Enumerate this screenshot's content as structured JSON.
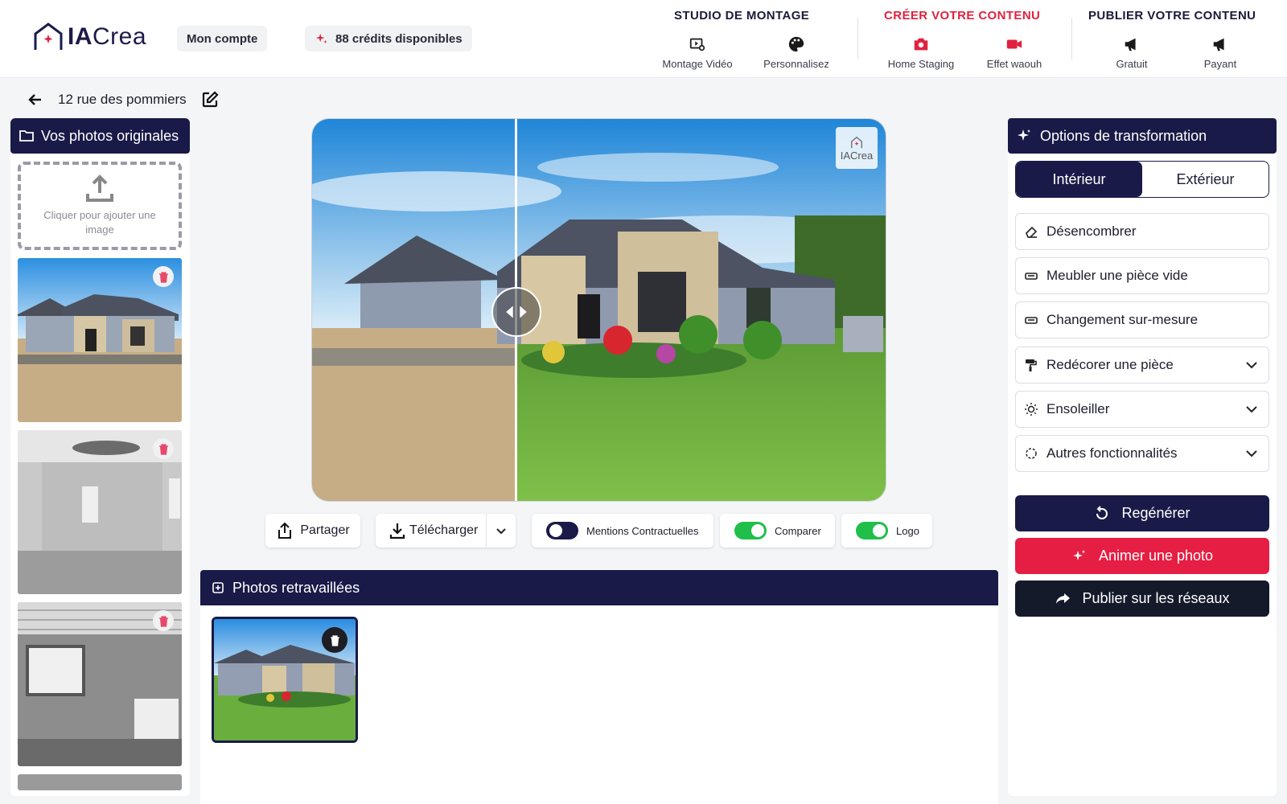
{
  "header": {
    "brand": "IACrea",
    "account_label": "Mon compte",
    "credits_label": "88 crédits disponibles",
    "groups": [
      {
        "title": "STUDIO DE MONTAGE",
        "color": "#1b1b3a",
        "items": [
          {
            "label": "Montage Vidéo",
            "icon": "video-edit-icon"
          },
          {
            "label": "Personnalisez",
            "icon": "palette-icon"
          }
        ]
      },
      {
        "title": "CRÉER VOTRE CONTENU",
        "color": "#e0223f",
        "items": [
          {
            "label": "Home Staging",
            "icon": "camera-icon"
          },
          {
            "label": "Effet waouh",
            "icon": "video-camera-icon"
          }
        ]
      },
      {
        "title": "PUBLIER VOTRE CONTENU",
        "color": "#1b1b3a",
        "items": [
          {
            "label": "Gratuit",
            "icon": "megaphone-icon"
          },
          {
            "label": "Payant",
            "icon": "megaphone-icon"
          }
        ]
      }
    ]
  },
  "breadcrumb": {
    "title": "12 rue des pommiers"
  },
  "left_panel": {
    "title": "Vos photos originales",
    "upload_text": "Cliquer pour ajouter une image",
    "photos": [
      "exterior-house-before",
      "empty-bedroom-grayscale",
      "kitchen-grayscale"
    ]
  },
  "viewer": {
    "watermark": "IACrea",
    "slider_fraction": 0.355
  },
  "toolbar": {
    "share_label": "Partager",
    "download_label": "Télécharger",
    "toggles": [
      {
        "label": "Mentions Contractuelles",
        "on": false
      },
      {
        "label": "Comparer",
        "on": true
      },
      {
        "label": "Logo",
        "on": true
      }
    ]
  },
  "retouched": {
    "title": "Photos retravaillées"
  },
  "right_panel": {
    "title": "Options de transformation",
    "tabs": [
      {
        "label": "Intérieur",
        "active": true
      },
      {
        "label": "Extérieur",
        "active": false
      }
    ],
    "options": [
      {
        "label": "Désencombrer",
        "icon": "eraser-icon",
        "dropdown": false
      },
      {
        "label": "Meubler une pièce vide",
        "icon": "sofa-icon",
        "dropdown": false
      },
      {
        "label": "Changement sur-mesure",
        "icon": "sofa-icon",
        "dropdown": false
      },
      {
        "label": "Redécorer une pièce",
        "icon": "paint-roller-icon",
        "dropdown": true
      },
      {
        "label": "Ensoleiller",
        "icon": "sun-icon",
        "dropdown": true
      },
      {
        "label": "Autres fonctionnalités",
        "icon": "dashed-circle-icon",
        "dropdown": true
      }
    ],
    "actions": [
      {
        "label": "Regénérer",
        "color": "#1a1a48",
        "icon": "refresh-icon"
      },
      {
        "label": "Animer une photo",
        "color": "#e61e43",
        "icon": "sparkle-icon"
      },
      {
        "label": "Publier sur les réseaux",
        "color": "#151a2b",
        "icon": "share-arrow-icon"
      }
    ]
  }
}
